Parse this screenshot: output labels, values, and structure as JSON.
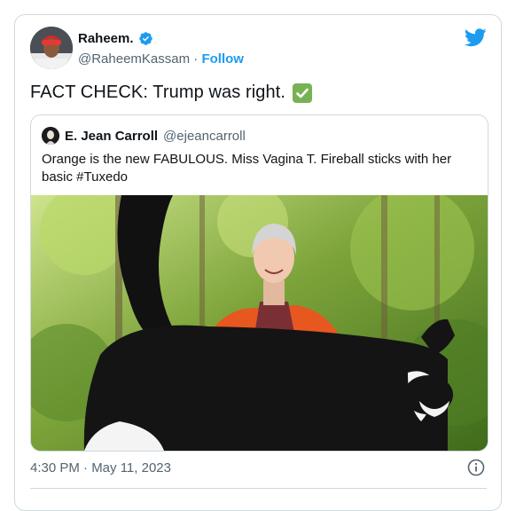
{
  "tweet": {
    "author": {
      "display_name": "Raheem.",
      "handle": "@RaheemKassam",
      "separator": "·",
      "follow_label": "Follow",
      "verified": true
    },
    "text": "FACT CHECK: Trump was right.",
    "emoji": "check-mark-button-emoji",
    "timestamp": "4:30 PM · May 11, 2023"
  },
  "quoted": {
    "author": {
      "display_name": "E. Jean Carroll",
      "handle": "@ejeancarroll"
    },
    "text": "Orange is the new FABULOUS.  Miss Vagina T. Fireball sticks with her basic #Tuxedo",
    "media": "photo-woman-in-orange-jacket-with-black-and-white-cat"
  },
  "colors": {
    "accent": "#1d9bf0",
    "text_primary": "#0f1419",
    "text_secondary": "#536471",
    "border": "#cfd9de",
    "check_green": "#77b255"
  }
}
